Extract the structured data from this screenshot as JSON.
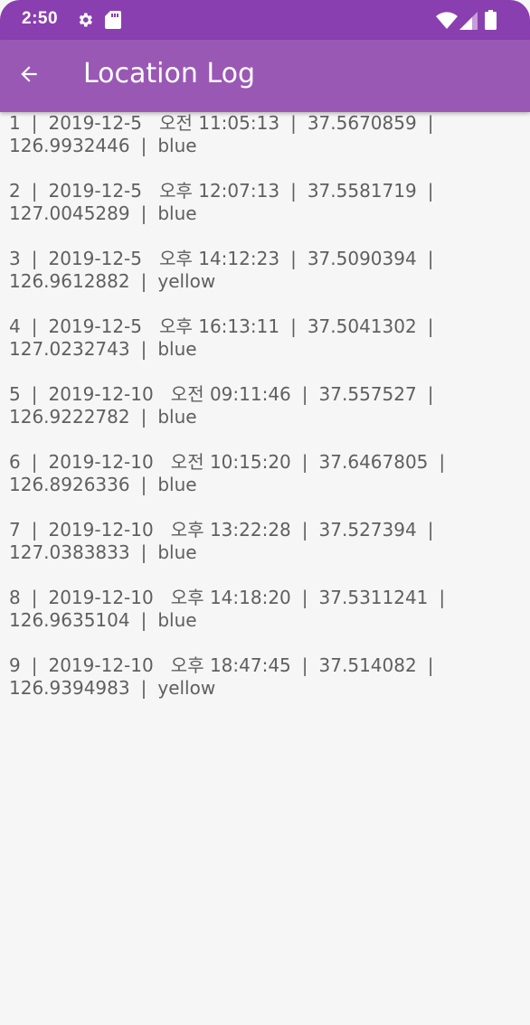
{
  "status_bar": {
    "time": "2:50",
    "icons": [
      "gear-icon",
      "sd-card-icon",
      "wifi-icon",
      "signal-icon",
      "battery-icon"
    ]
  },
  "app_bar": {
    "title": "Location Log",
    "back_icon": "arrow-left-icon"
  },
  "entries": [
    {
      "id": "1",
      "date": "2019-12-5",
      "time": "오전 11:05:13",
      "lat": "37.5670859",
      "lng": "126.9932446",
      "color": "blue"
    },
    {
      "id": "2",
      "date": "2019-12-5",
      "time": "오후 12:07:13",
      "lat": "37.5581719",
      "lng": "127.0045289",
      "color": "blue"
    },
    {
      "id": "3",
      "date": "2019-12-5",
      "time": "오후 14:12:23",
      "lat": "37.5090394",
      "lng": "126.9612882",
      "color": "yellow"
    },
    {
      "id": "4",
      "date": "2019-12-5",
      "time": "오후 16:13:11",
      "lat": "37.5041302",
      "lng": "127.0232743",
      "color": "blue"
    },
    {
      "id": "5",
      "date": "2019-12-10",
      "time": "오전 09:11:46",
      "lat": "37.557527",
      "lng": "126.9222782",
      "color": "blue"
    },
    {
      "id": "6",
      "date": "2019-12-10",
      "time": "오전 10:15:20",
      "lat": "37.6467805",
      "lng": "126.8926336",
      "color": "blue"
    },
    {
      "id": "7",
      "date": "2019-12-10",
      "time": "오후 13:22:28",
      "lat": "37.527394",
      "lng": "127.0383833",
      "color": "blue"
    },
    {
      "id": "8",
      "date": "2019-12-10",
      "time": "오후 14:18:20",
      "lat": "37.5311241",
      "lng": "126.9635104",
      "color": "blue"
    },
    {
      "id": "9",
      "date": "2019-12-10",
      "time": "오후 18:47:45",
      "lat": "37.514082",
      "lng": "126.9394983",
      "color": "yellow"
    }
  ],
  "theme": {
    "status_bar_color": "#8a3fb0",
    "app_bar_color": "#9a58b5",
    "background_color": "#f6f6f6",
    "text_color": "#5f5f5f"
  }
}
